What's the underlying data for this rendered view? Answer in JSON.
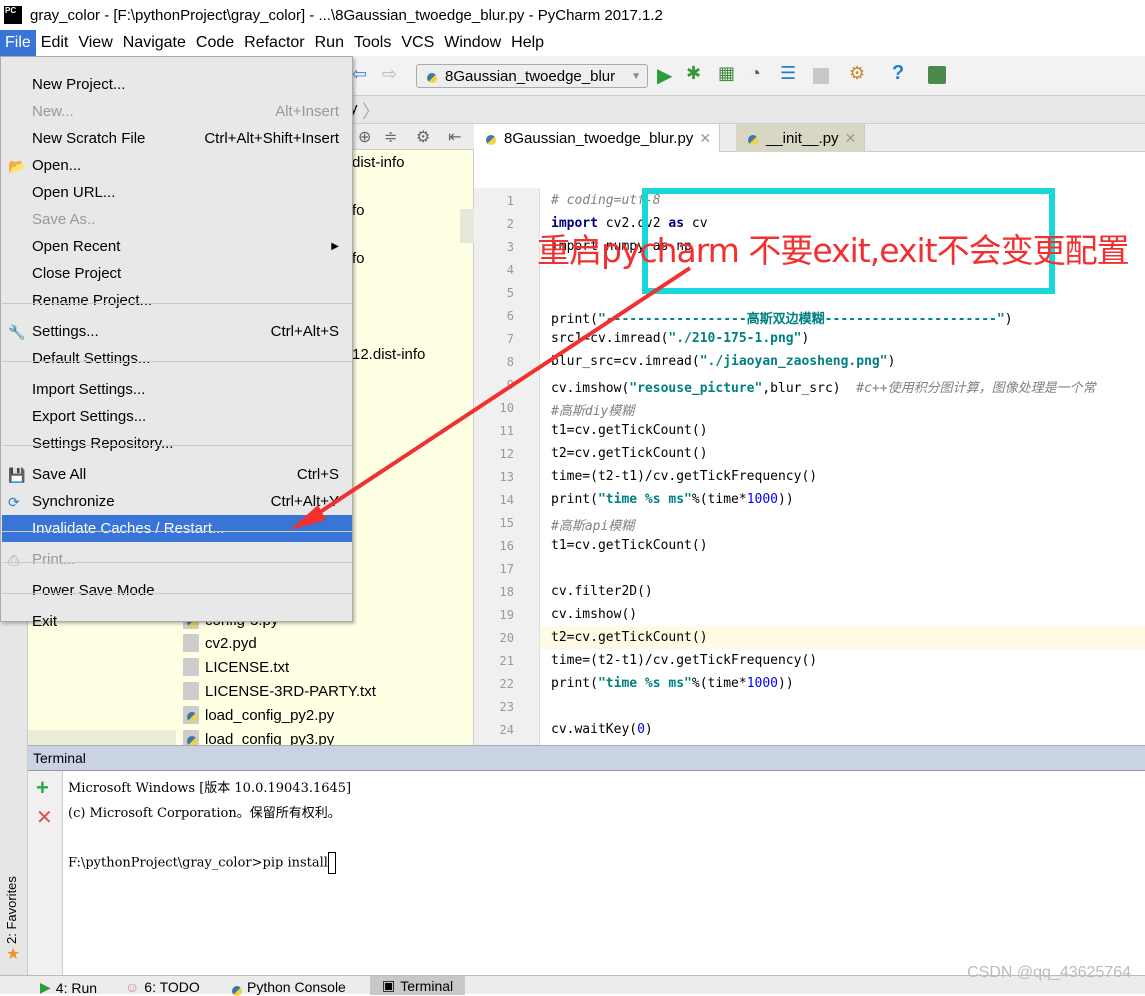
{
  "window": {
    "title": "gray_color - [F:\\pythonProject\\gray_color] - ...\\8Gaussian_twoedge_blur.py - PyCharm 2017.1.2",
    "logo": "PC"
  },
  "menubar": [
    "File",
    "Edit",
    "View",
    "Navigate",
    "Code",
    "Refactor",
    "Run",
    "Tools",
    "VCS",
    "Window",
    "Help"
  ],
  "toolbar": {
    "run_config": "8Gaussian_twoedge_blur",
    "icons": [
      "back-icon",
      "forward-icon",
      "run-icon",
      "debug-icon",
      "coverage-icon",
      "profile-icon",
      "concurrency-icon",
      "stop-icon",
      "settings-wrench-icon",
      "help-icon",
      "sdk-icon"
    ]
  },
  "navbar": {
    "crumb": "y"
  },
  "file_menu": [
    {
      "label": "New Project...",
      "shortcut": ""
    },
    {
      "label": "New...",
      "shortcut": "Alt+Insert",
      "disabled": true
    },
    {
      "label": "New Scratch File",
      "shortcut": "Ctrl+Alt+Shift+Insert"
    },
    {
      "label": "Open...",
      "shortcut": ""
    },
    {
      "label": "Open URL...",
      "shortcut": ""
    },
    {
      "label": "Save As..",
      "shortcut": "",
      "disabled": true
    },
    {
      "label": "Open Recent",
      "shortcut": ""
    },
    {
      "label": "Close Project",
      "shortcut": ""
    },
    {
      "label": "Rename Project...",
      "shortcut": ""
    },
    {
      "label": "Settings...",
      "shortcut": "Ctrl+Alt+S"
    },
    {
      "label": "Default Settings...",
      "shortcut": ""
    },
    {
      "label": "Import Settings...",
      "shortcut": ""
    },
    {
      "label": "Export Settings...",
      "shortcut": ""
    },
    {
      "label": "Settings Repository...",
      "shortcut": ""
    },
    {
      "label": "Save All",
      "shortcut": "Ctrl+S"
    },
    {
      "label": "Synchronize",
      "shortcut": "Ctrl+Alt+Y"
    },
    {
      "label": "Invalidate Caches / Restart...",
      "shortcut": "",
      "highlighted": true
    },
    {
      "label": "Print...",
      "shortcut": "",
      "disabled": true
    },
    {
      "label": "Power Save Mode",
      "shortcut": ""
    },
    {
      "label": "Exit",
      "shortcut": ""
    }
  ],
  "tree": {
    "items": [
      "dist-info",
      "fo",
      "fo",
      "12.dist-info",
      "config-3.py",
      "cv2.pyd",
      "LICENSE.txt",
      "LICENSE-3RD-PARTY.txt",
      "load_config_py2.py",
      "load_config_py3.py"
    ]
  },
  "tabs": [
    {
      "label": "8Gaussian_twoedge_blur.py",
      "active": true
    },
    {
      "label": "__init__.py",
      "active": false
    }
  ],
  "editor": {
    "line_numbers": [
      "1",
      "2",
      "3",
      "4",
      "5",
      "6",
      "7",
      "8",
      "9",
      "10",
      "11",
      "12",
      "13",
      "14",
      "15",
      "16",
      "17",
      "18",
      "19",
      "20",
      "21",
      "22",
      "23",
      "24"
    ],
    "lines": [
      [
        [
          "# coding=utf-8",
          "cm"
        ]
      ],
      [
        [
          "import",
          "kw"
        ],
        [
          " cv2.cv2 ",
          ""
        ],
        [
          "as",
          "kw"
        ],
        [
          " cv",
          ""
        ]
      ],
      [
        [
          "import numpy as np",
          ""
        ]
      ],
      [],
      [],
      [
        [
          "print(",
          ""
        ],
        [
          "\"------------------高斯双边模糊----------------------\"",
          "str"
        ],
        [
          ")",
          ""
        ]
      ],
      [
        [
          "src1=cv.imread(",
          ""
        ],
        [
          "\"./210-175-1.png\"",
          "str"
        ],
        [
          ")",
          ""
        ]
      ],
      [
        [
          "blur_src=cv.imread(",
          ""
        ],
        [
          "\"./jiaoyan_zaosheng.png\"",
          "str"
        ],
        [
          ")",
          ""
        ]
      ],
      [
        [
          "cv.imshow(",
          ""
        ],
        [
          "\"resouse_picture\"",
          "str"
        ],
        [
          ",blur_src)  ",
          ""
        ],
        [
          "#c++使用积分图计算，图像处理是一个常",
          "cm"
        ]
      ],
      [
        [
          "#高斯diy模糊",
          "cm"
        ]
      ],
      [
        [
          "t1=cv.getTickCount()",
          ""
        ]
      ],
      [
        [
          "t2=cv.getTickCount()",
          ""
        ]
      ],
      [
        [
          "time=(t2-t1)/cv.getTickFrequency()",
          ""
        ]
      ],
      [
        [
          "print(",
          ""
        ],
        [
          "\"time %s ms\"",
          "str"
        ],
        [
          "%(time*",
          ""
        ],
        [
          "1000",
          "num"
        ],
        [
          "))",
          ""
        ]
      ],
      [
        [
          "#高斯api模糊",
          "cm"
        ]
      ],
      [
        [
          "t1=cv.getTickCount()",
          ""
        ]
      ],
      [],
      [
        [
          "cv.filter2D()",
          ""
        ]
      ],
      [
        [
          "cv.imshow()",
          ""
        ]
      ],
      [
        [
          "t2=cv.getTickCount()",
          ""
        ]
      ],
      [
        [
          "time=(t2-t1)/cv.getTickFrequency()",
          ""
        ]
      ],
      [
        [
          "print(",
          ""
        ],
        [
          "\"time %s ms\"",
          "str"
        ],
        [
          "%(time*",
          ""
        ],
        [
          "1000",
          "num"
        ],
        [
          "))",
          ""
        ]
      ],
      [],
      [
        [
          "cv.waitKey(",
          ""
        ],
        [
          "0",
          "num"
        ],
        [
          ")",
          ""
        ]
      ]
    ]
  },
  "terminal": {
    "title": "Terminal",
    "lines": [
      "Microsoft Windows [版本 10.0.19043.1645]",
      "(c) Microsoft Corporation。保留所有权利。",
      "",
      "F:\\pythonProject\\gray_color>pip install"
    ]
  },
  "favorites": "2: Favorites",
  "bottom_tabs": [
    "4: Run",
    "6: TODO",
    "Python Console",
    "Terminal"
  ],
  "annotation": {
    "text": "重启pycharm 不要exit,exit不会变更配置",
    "box_color": "#19d7d8",
    "text_color": "#f23030"
  },
  "watermark": "CSDN @qq_43625764"
}
